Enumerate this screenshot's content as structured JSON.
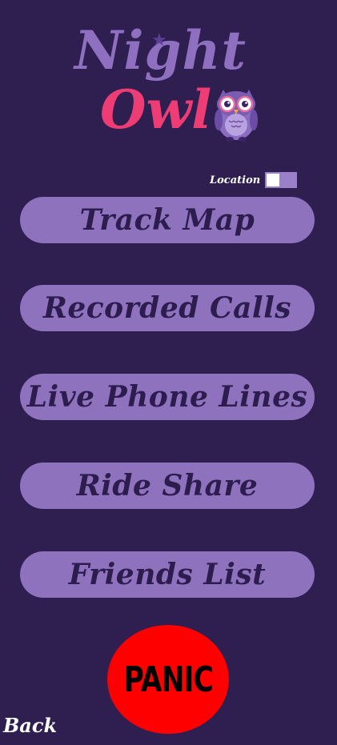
{
  "logo": {
    "line1": "Night",
    "line2": "Owl",
    "colors": {
      "night": "#8e6fc0",
      "owl": "#ee3d75",
      "owl_icon_body": "#8a6cc0"
    }
  },
  "location_toggle": {
    "label": "Location",
    "state": "off"
  },
  "menu": {
    "items": [
      {
        "label": "Track Map"
      },
      {
        "label": "Recorded Calls"
      },
      {
        "label": "Live Phone Lines"
      },
      {
        "label": "Ride Share"
      },
      {
        "label": "Friends List"
      }
    ]
  },
  "panic": {
    "label": "PANIC",
    "color": "#ff0000"
  },
  "nav": {
    "back_label": "Back"
  },
  "theme": {
    "background": "#2f1f50",
    "button_fill": "#8e72bd",
    "button_text": "#2d1d4f"
  }
}
